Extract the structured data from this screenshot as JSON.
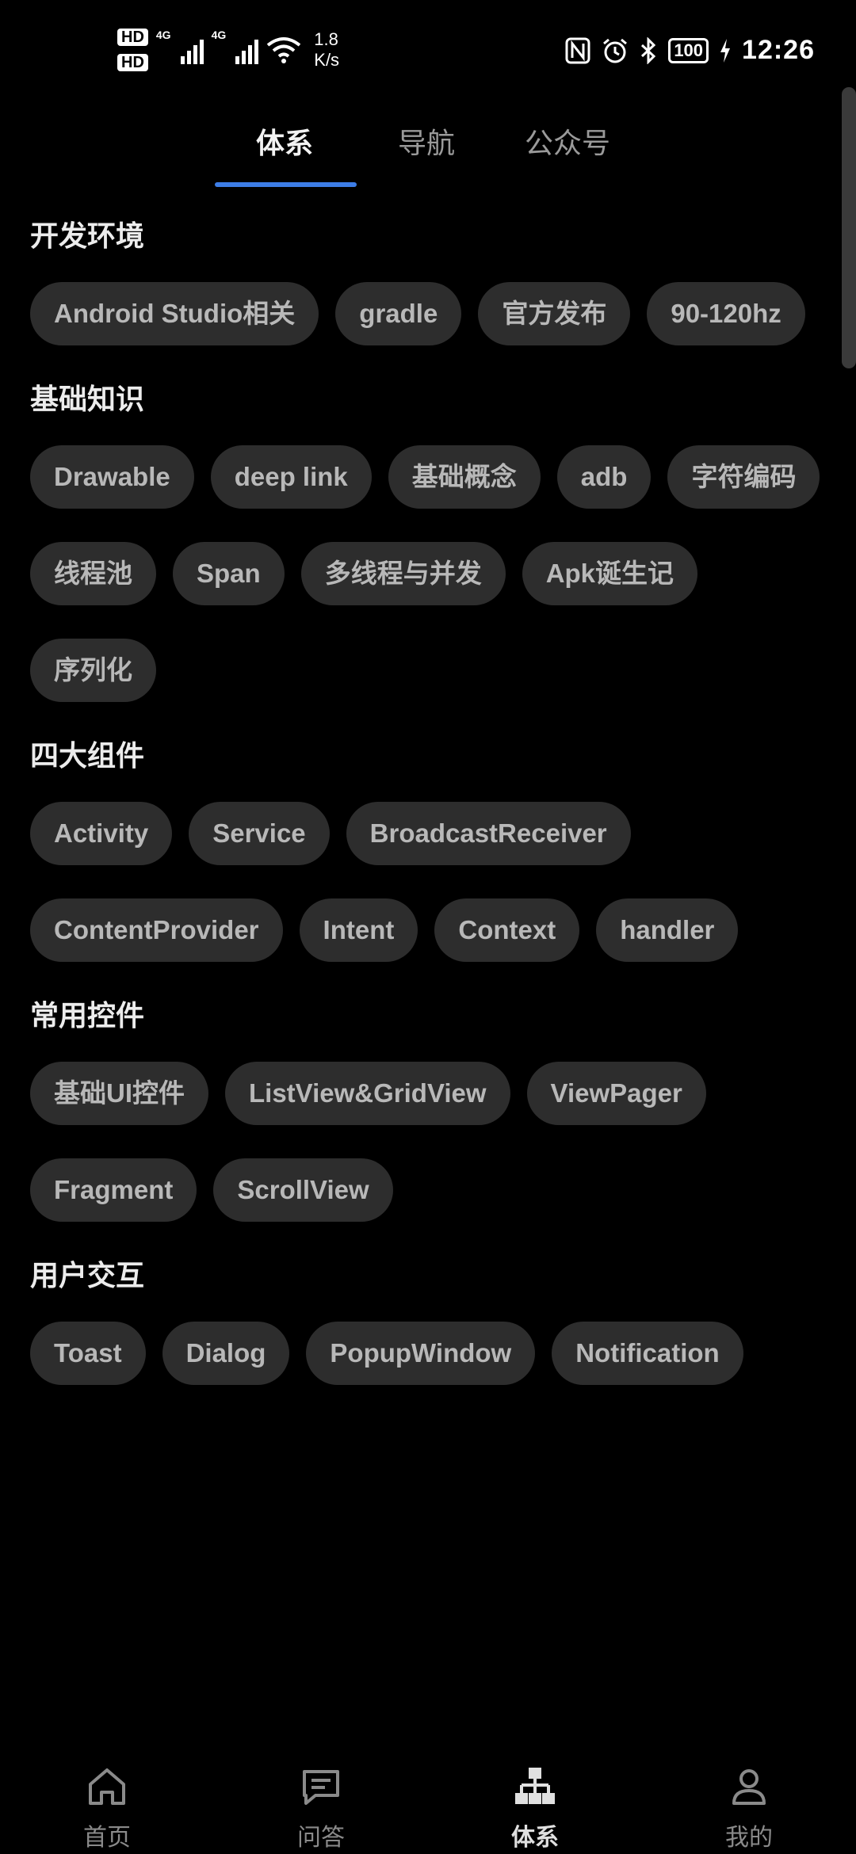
{
  "status_bar": {
    "hd1": "HD",
    "hd2": "HD",
    "net1": "4G",
    "net2": "4G",
    "speed_value": "1.8",
    "speed_unit": "K/s",
    "battery": "100",
    "time": "12:26"
  },
  "tabs": [
    {
      "label": "体系",
      "active": true
    },
    {
      "label": "导航",
      "active": false
    },
    {
      "label": "公众号",
      "active": false
    }
  ],
  "sections": [
    {
      "title": "开发环境",
      "chips": [
        "Android Studio相关",
        "gradle",
        "官方发布",
        "90-120hz"
      ]
    },
    {
      "title": "基础知识",
      "chips": [
        "Drawable",
        "deep link",
        "基础概念",
        "adb",
        "字符编码",
        "线程池",
        "Span",
        "多线程与并发",
        "Apk诞生记",
        "序列化"
      ]
    },
    {
      "title": "四大组件",
      "chips": [
        "Activity",
        "Service",
        "BroadcastReceiver",
        "ContentProvider",
        "Intent",
        "Context",
        "handler"
      ]
    },
    {
      "title": "常用控件",
      "chips": [
        "基础UI控件",
        "ListView&GridView",
        "ViewPager",
        "Fragment",
        "ScrollView"
      ]
    },
    {
      "title": "用户交互",
      "chips": [
        "Toast",
        "Dialog",
        "PopupWindow",
        "Notification"
      ]
    }
  ],
  "bottom_nav": [
    {
      "label": "首页",
      "icon": "home-icon",
      "active": false
    },
    {
      "label": "问答",
      "icon": "chat-icon",
      "active": false
    },
    {
      "label": "体系",
      "icon": "hierarchy-icon",
      "active": true
    },
    {
      "label": "我的",
      "icon": "person-icon",
      "active": false
    }
  ],
  "colors": {
    "background": "#000000",
    "chip_bg": "#2d2d2d",
    "chip_text": "#b8b8b8",
    "accent": "#3d7de6"
  }
}
